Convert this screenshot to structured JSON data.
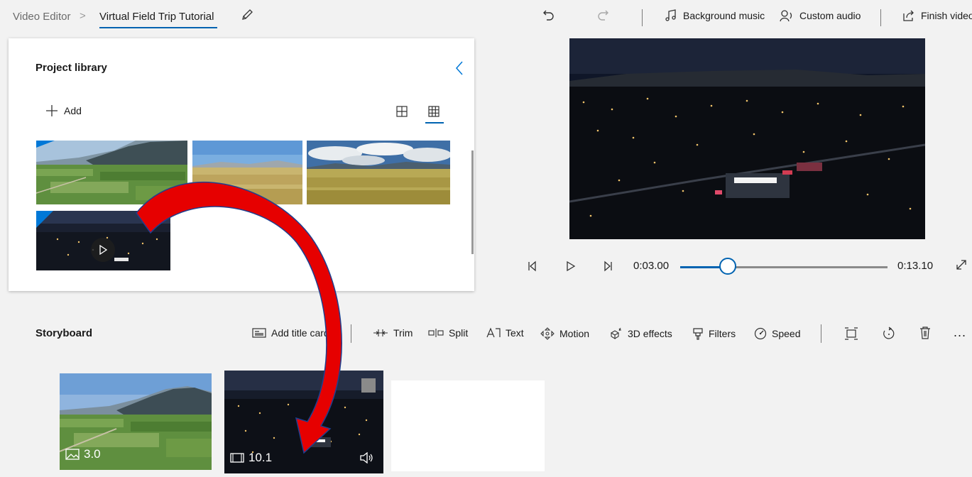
{
  "breadcrumb": {
    "root": "Video Editor",
    "separator": ">",
    "project_title": "Virtual Field Trip Tutorial"
  },
  "toolbar": {
    "background_music": "Background music",
    "custom_audio": "Custom audio",
    "finish_video": "Finish video"
  },
  "library": {
    "title": "Project library",
    "add_label": "Add",
    "items": [
      {
        "type": "image",
        "scene": "aerial farmland with mountains"
      },
      {
        "type": "image",
        "scene": "golden grassland"
      },
      {
        "type": "image",
        "scene": "grass field under cloudy sky"
      },
      {
        "type": "video",
        "scene": "night city lights"
      }
    ]
  },
  "player": {
    "current_time": "0:03.00",
    "total_time": "0:13.10",
    "progress": 0.23
  },
  "storyboard": {
    "title": "Storyboard",
    "actions": {
      "add_title_card": "Add title card",
      "trim": "Trim",
      "split": "Split",
      "text": "Text",
      "motion": "Motion",
      "effects_3d": "3D effects",
      "filters": "Filters",
      "speed": "Speed"
    },
    "more": "...",
    "cards": [
      {
        "type": "image",
        "duration": "3.0"
      },
      {
        "type": "video",
        "duration": "10.1"
      }
    ]
  },
  "colors": {
    "accent": "#0078d7",
    "arrow_fill": "#e60000",
    "arrow_stroke": "#1f3f8f"
  }
}
